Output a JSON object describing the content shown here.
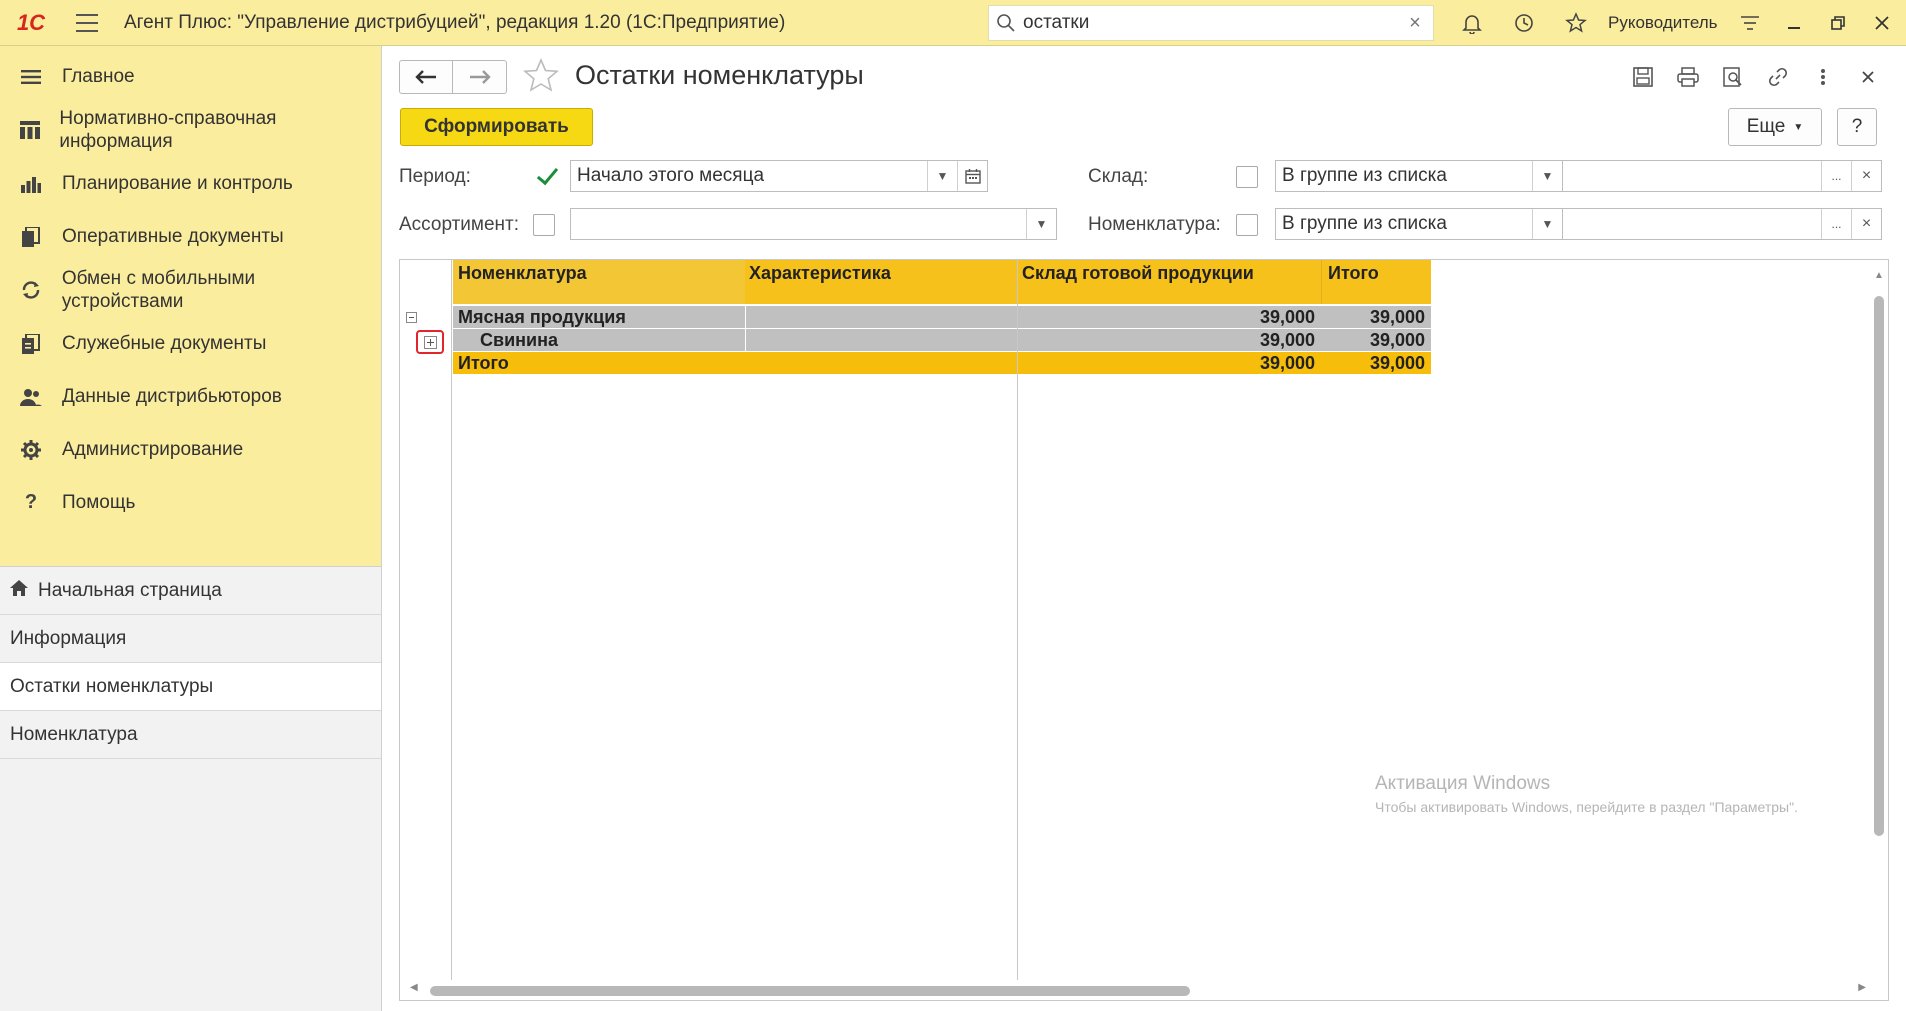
{
  "app": {
    "logo_text": "1С",
    "title": "Агент Плюс: \"Управление дистрибуцией\", редакция 1.20  (1С:Предприятие)",
    "search_value": "остатки",
    "user": "Руководитель"
  },
  "sidebar": {
    "nav": [
      {
        "label": "Главное",
        "icon": "menu-lines-icon"
      },
      {
        "label": "Нормативно-справочная информация",
        "icon": "catalog-icon"
      },
      {
        "label": "Планирование и контроль",
        "icon": "bar-chart-icon"
      },
      {
        "label": "Оперативные документы",
        "icon": "documents-icon"
      },
      {
        "label": "Обмен с мобильными устройствами",
        "icon": "sync-icon"
      },
      {
        "label": "Служебные документы",
        "icon": "service-docs-icon"
      },
      {
        "label": "Данные дистрибьюторов",
        "icon": "people-icon"
      },
      {
        "label": "Администрирование",
        "icon": "gear-icon"
      },
      {
        "label": "Помощь",
        "icon": "question-icon"
      }
    ],
    "open": [
      {
        "label": "Начальная страница"
      },
      {
        "label": "Информация"
      },
      {
        "label": "Остатки номенклатуры"
      },
      {
        "label": "Номенклатура"
      }
    ]
  },
  "form": {
    "title": "Остатки номенклатуры",
    "generate_button": "Сформировать",
    "more_button": "Еще",
    "help_button": "?",
    "period_label": "Период:",
    "period_value": "Начало этого месяца",
    "period_checked": true,
    "warehouse_label": "Склад:",
    "warehouse_mode": "В группе из списка",
    "warehouse_value": "",
    "assortment_label": "Ассортимент:",
    "assortment_value": "",
    "nomenclature_label": "Номенклатура:",
    "nomenclature_mode": "В группе из списка",
    "nomenclature_value": "",
    "ellipsis": "...",
    "clear": "×"
  },
  "report": {
    "headers": {
      "nomenclature": "Номенклатура",
      "characteristic": "Характеристика",
      "warehouse": "Склад готовой продукции",
      "total": "Итого"
    },
    "rows": [
      {
        "name": "Мясная продукция",
        "warehouse": "39,000",
        "total": "39,000"
      },
      {
        "name": "Свинина",
        "warehouse": "39,000",
        "total": "39,000"
      }
    ],
    "total_row": {
      "name": "Итого",
      "warehouse": "39,000",
      "total": "39,000"
    }
  },
  "watermark": {
    "line1": "Активация Windows",
    "line2": "Чтобы активировать Windows, перейдите в раздел \"Параметры\"."
  }
}
